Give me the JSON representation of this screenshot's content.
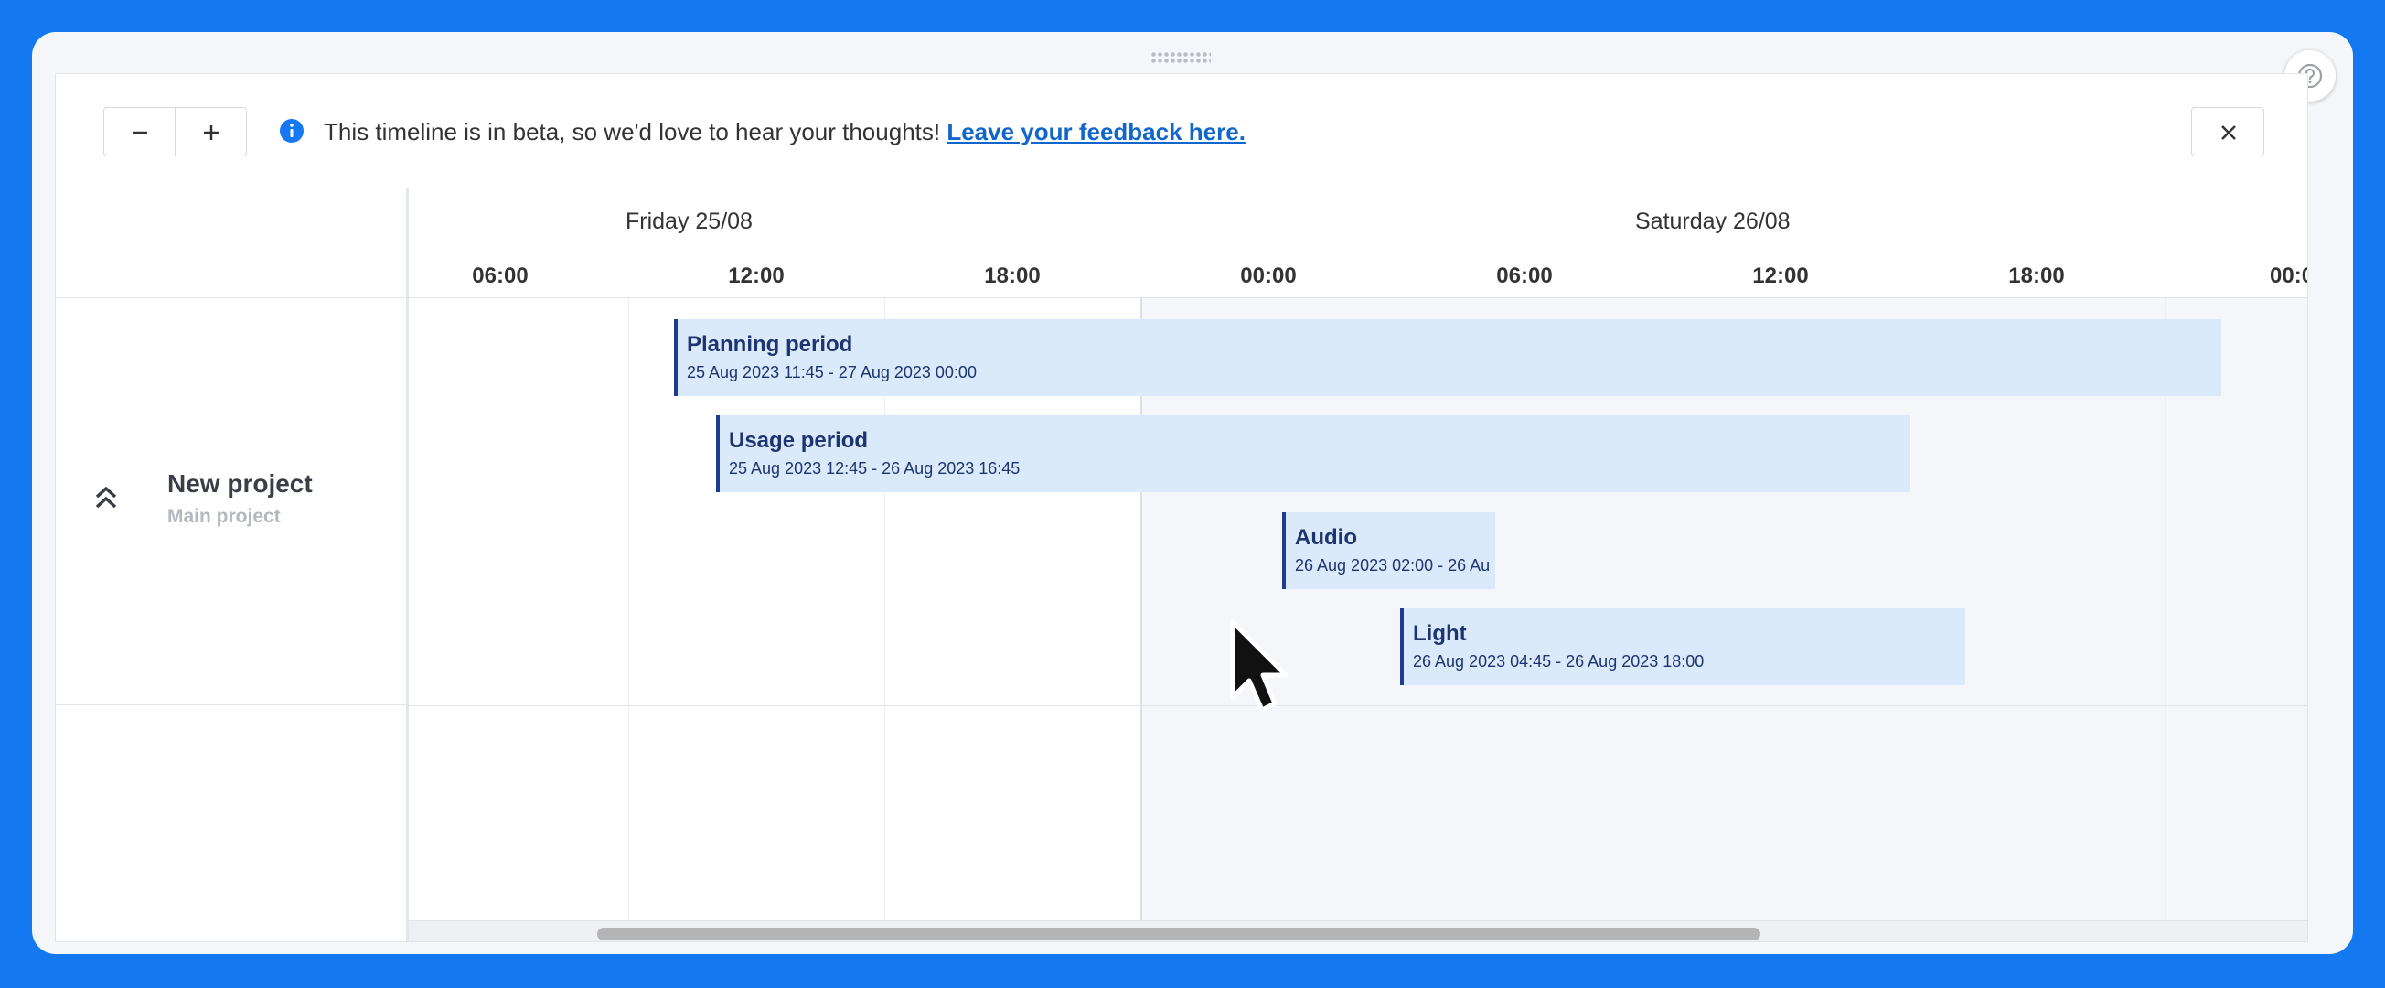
{
  "toolbar": {
    "zoom_out_icon": "minus-icon",
    "zoom_in_icon": "plus-icon",
    "info_icon": "info-icon",
    "banner_text": "This timeline is in beta, so we'd love to hear your thoughts! ",
    "banner_link": "Leave your feedback here.",
    "close_icon": "close-icon"
  },
  "help_icon": "question-circle-icon",
  "project": {
    "name": "New project",
    "subtitle": "Main project",
    "collapse_icon": "chevron-double-up-icon"
  },
  "timeline": {
    "days": [
      "Friday 25/08",
      "Saturday 26/08"
    ],
    "hours": [
      "06:00",
      "12:00",
      "18:00",
      "00:00",
      "06:00",
      "12:00",
      "18:00",
      "00:0"
    ],
    "bars": [
      {
        "title": "Planning period",
        "dates": "25 Aug 2023 11:45 - 27 Aug 2023 00:00"
      },
      {
        "title": "Usage period",
        "dates": "25 Aug 2023 12:45 - 26 Aug 2023 16:45"
      },
      {
        "title": "Audio",
        "dates": "26 Aug 2023 02:00 - 26 Au"
      },
      {
        "title": "Light",
        "dates": "26 Aug 2023 04:45 - 26 Aug 2023 18:00"
      }
    ]
  },
  "colors": {
    "background": "#1478f0",
    "bar_fill": "#dbeafb",
    "bar_accent": "#1d3c8f",
    "link": "#1166cc"
  }
}
